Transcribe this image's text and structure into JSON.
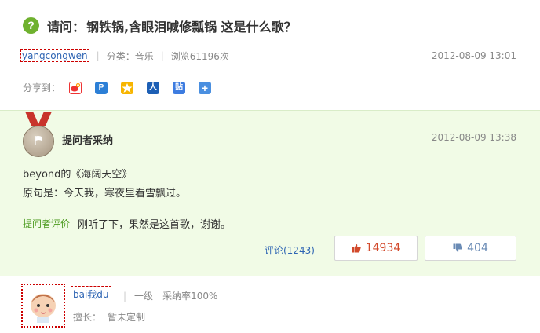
{
  "question": {
    "icon_text": "?",
    "prefix": "请问：",
    "title": "钢铁锅,含眼泪喊修瓢锅 这是什么歌？"
  },
  "meta": {
    "asker": "yangcongwen",
    "category": "分类：音乐",
    "views": "浏览61196次",
    "time": "2012-08-09 13:01"
  },
  "share": {
    "label": "分享到：",
    "icons": [
      "weibo-icon",
      "qzone-icon",
      "tqq-icon",
      "renren-icon",
      "tieba-icon",
      "more-share-icon"
    ]
  },
  "best_answer": {
    "label": "提问者采纳",
    "time": "2012-08-09 13:38",
    "line1": "beyond的《海阔天空》",
    "line2": "原句是：今天我，寒夜里看雪飘过。",
    "eval_label": "提问者评价",
    "eval_text": "刚听了下，果然是这首歌，谢谢。",
    "comments": "评论(1243)",
    "upvotes": "14934",
    "downvotes": "404"
  },
  "answerer": {
    "name": "bai我du",
    "level": "一级",
    "adopt_rate": "采纳率100%",
    "expert_label": "擅长：",
    "expert_value": "暂未定制"
  },
  "colors": {
    "accent_green": "#6fb12f",
    "link_blue": "#2d64b3",
    "panel_bg": "#f1fbe6",
    "upvote_red": "#d2492b"
  }
}
